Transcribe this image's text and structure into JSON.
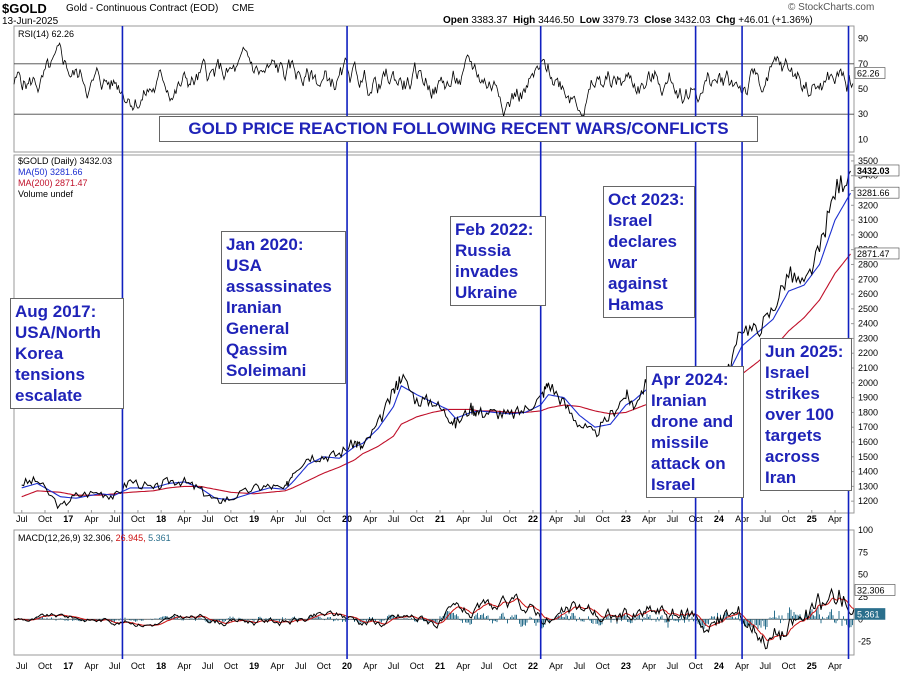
{
  "header": {
    "symbol": "$GOLD",
    "name": "Gold - Continuous Contract (EOD)",
    "exchange": "CME",
    "date": "13-Jun-2025",
    "open_label": "Open",
    "open": "3383.37",
    "high_label": "High",
    "high": "3446.50",
    "low_label": "Low",
    "low": "3379.73",
    "close_label": "Close",
    "close": "3432.03",
    "chg_label": "Chg",
    "chg": "+46.01 (+1.36%)",
    "watermark": "© StockCharts.com"
  },
  "chart_data": [
    {
      "type": "line",
      "title": "GOLD PRICE REACTION FOLLOWING RECENT WARS/CONFLICTS",
      "panel": "price",
      "legend": {
        "price": "$GOLD (Daily) 3432.03",
        "ma50": "MA(50) 3281.66",
        "ma200": "MA(200) 2871.47",
        "volume": "Volume undef"
      },
      "x_ticks": [
        "Jul",
        "Oct",
        "17",
        "Apr",
        "Jul",
        "Oct",
        "18",
        "Apr",
        "Jul",
        "Oct",
        "19",
        "Apr",
        "Jul",
        "Oct",
        "20",
        "Apr",
        "Jul",
        "Oct",
        "21",
        "Apr",
        "Jul",
        "Oct",
        "22",
        "Apr",
        "Jul",
        "Oct",
        "23",
        "Apr",
        "Jul",
        "Oct",
        "24",
        "Apr",
        "Jul",
        "Oct",
        "25",
        "Apr"
      ],
      "y_ticks": [
        1200,
        1300,
        1400,
        1500,
        1600,
        1700,
        1800,
        1900,
        2000,
        2100,
        2200,
        2300,
        2400,
        2500,
        2600,
        2700,
        2800,
        2900,
        3000,
        3100,
        3200,
        3300,
        3400,
        3500
      ],
      "ylim": [
        1120,
        3540
      ],
      "last_labels": {
        "close": "3432.03",
        "ma50": "3281.66",
        "ma200": "2871.47"
      },
      "x": [
        "2016-07",
        "2016-09",
        "2016-12",
        "2017-02",
        "2017-05",
        "2017-07",
        "2017-09",
        "2017-12",
        "2018-02",
        "2018-04",
        "2018-06",
        "2018-08",
        "2018-10",
        "2019-01",
        "2019-03",
        "2019-05",
        "2019-06",
        "2019-08",
        "2019-10",
        "2019-12",
        "2020-02",
        "2020-03",
        "2020-05",
        "2020-07",
        "2020-08",
        "2020-10",
        "2020-12",
        "2021-02",
        "2021-03",
        "2021-05",
        "2021-06",
        "2021-08",
        "2021-10",
        "2021-12",
        "2022-02",
        "2022-03",
        "2022-05",
        "2022-07",
        "2022-09",
        "2022-11",
        "2023-01",
        "2023-02",
        "2023-04",
        "2023-06",
        "2023-08",
        "2023-10",
        "2023-12",
        "2024-02",
        "2024-04",
        "2024-06",
        "2024-08",
        "2024-10",
        "2024-12",
        "2025-02",
        "2025-04",
        "2025-06"
      ],
      "series": [
        {
          "name": "$GOLD",
          "values": [
            1320,
            1340,
            1160,
            1240,
            1260,
            1230,
            1340,
            1280,
            1340,
            1330,
            1280,
            1200,
            1220,
            1290,
            1300,
            1280,
            1400,
            1500,
            1500,
            1520,
            1600,
            1560,
            1720,
            1940,
            2050,
            1880,
            1880,
            1780,
            1720,
            1830,
            1800,
            1800,
            1780,
            1820,
            1900,
            2000,
            1860,
            1720,
            1650,
            1780,
            1920,
            1850,
            2030,
            1950,
            1940,
            1920,
            2070,
            2050,
            2380,
            2350,
            2500,
            2740,
            2650,
            2900,
            3300,
            3432
          ]
        },
        {
          "name": "MA(50)",
          "values": [
            1290,
            1320,
            1230,
            1220,
            1250,
            1240,
            1290,
            1290,
            1320,
            1330,
            1290,
            1220,
            1210,
            1260,
            1290,
            1280,
            1330,
            1450,
            1500,
            1490,
            1570,
            1590,
            1690,
            1840,
            1980,
            1920,
            1870,
            1820,
            1760,
            1800,
            1810,
            1800,
            1790,
            1800,
            1850,
            1920,
            1900,
            1780,
            1700,
            1720,
            1850,
            1880,
            1970,
            1970,
            1950,
            1920,
            2000,
            2040,
            2250,
            2340,
            2430,
            2620,
            2660,
            2800,
            3100,
            3282
          ]
        },
        {
          "name": "MA(200)",
          "values": [
            1230,
            1270,
            1260,
            1240,
            1240,
            1250,
            1260,
            1270,
            1290,
            1300,
            1300,
            1280,
            1260,
            1250,
            1260,
            1270,
            1290,
            1340,
            1390,
            1430,
            1480,
            1520,
            1570,
            1640,
            1720,
            1770,
            1800,
            1820,
            1820,
            1820,
            1810,
            1810,
            1800,
            1800,
            1810,
            1830,
            1850,
            1840,
            1810,
            1790,
            1800,
            1820,
            1860,
            1890,
            1920,
            1930,
            1960,
            1990,
            2060,
            2140,
            2230,
            2350,
            2440,
            2560,
            2740,
            2871
          ]
        }
      ]
    },
    {
      "type": "line",
      "panel": "RSI",
      "legend": "RSI(14) 62.26",
      "y_ticks": [
        10,
        30,
        50,
        70,
        90
      ],
      "ylim": [
        0,
        100
      ],
      "overbought": 70,
      "oversold": 30,
      "last_label": "62.26"
    },
    {
      "type": "line",
      "panel": "MACD",
      "legend": {
        "label": "MACD(12,26,9)",
        "macd": "32.306,",
        "signal": "26.945,",
        "hist": "5.361"
      },
      "y_ticks": [
        -25,
        0,
        25,
        50,
        75,
        100
      ],
      "ylim": [
        -40,
        100
      ],
      "last_labels": {
        "macd": "32.306",
        "hist": "5.361"
      }
    }
  ],
  "annotations": [
    {
      "date": "2017-08",
      "lines": [
        "Aug 2017:",
        "USA/North",
        "Korea",
        "tensions",
        "escalate"
      ]
    },
    {
      "date": "2020-01",
      "lines": [
        "Jan 2020:",
        "USA",
        "assassinates",
        "Iranian",
        "General",
        "Qassim",
        "Soleimani"
      ]
    },
    {
      "date": "2022-02",
      "lines": [
        "Feb 2022:",
        "Russia",
        "invades",
        "Ukraine"
      ]
    },
    {
      "date": "2023-10",
      "lines": [
        "Oct 2023:",
        "Israel",
        "declares",
        "war",
        "against",
        "Hamas"
      ]
    },
    {
      "date": "2024-04",
      "lines": [
        "Apr 2024:",
        "Iranian",
        "drone and",
        "missile",
        "attack on",
        "Israel"
      ]
    },
    {
      "date": "2025-06",
      "lines": [
        "Jun 2025:",
        "Israel",
        "strikes",
        "over 100",
        "targets",
        "across",
        "Iran"
      ]
    }
  ],
  "colors": {
    "price": "#000000",
    "ma50": "#1c2fd0",
    "ma200": "#c0102a",
    "event_line": "#1020c0",
    "annotation_text": "#1f23b8",
    "macd_line": "#000000",
    "macd_signal": "#cc1010",
    "macd_hist": "#2a6f8c"
  }
}
